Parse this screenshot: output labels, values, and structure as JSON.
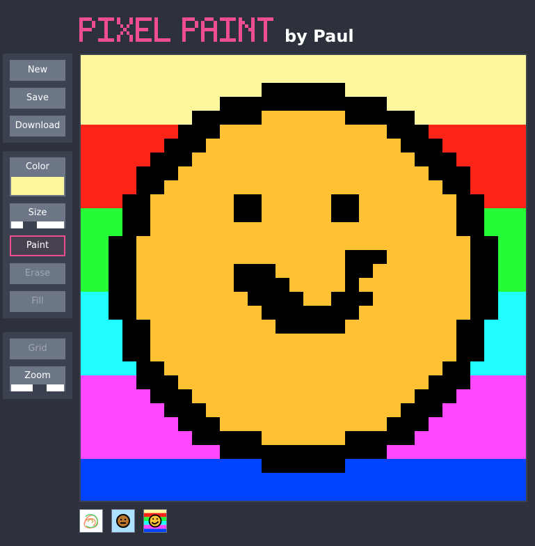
{
  "header": {
    "logo_text": "PIXEL PAINT",
    "byline": "by Paul",
    "logo_color": "#ee4e8f"
  },
  "file_panel": {
    "new_label": "New",
    "save_label": "Save",
    "download_label": "Download"
  },
  "tool_panel": {
    "color_label": "Color",
    "current_color": "#fff79c",
    "size_label": "Size",
    "size_level": 0.3,
    "paint_label": "Paint",
    "erase_label": "Erase",
    "fill_label": "Fill",
    "active_tool": "paint"
  },
  "view_panel": {
    "grid_label": "Grid",
    "zoom_label": "Zoom",
    "zoom_level": 0.55
  },
  "canvas": {
    "grid_size": 32,
    "stripes": [
      {
        "color": "#fff79c",
        "rows": 5
      },
      {
        "color": "#ff2418",
        "rows": 6
      },
      {
        "color": "#25fb36",
        "rows": 6
      },
      {
        "color": "#20fdff",
        "rows": 6
      },
      {
        "color": "#ff48ff",
        "rows": 6
      },
      {
        "color": "#0043ff",
        "rows": 3
      }
    ],
    "face_color": "#ffc234",
    "outline_color": "#000000"
  },
  "gallery": [
    {
      "name": "scribble-drawing-thumbnail"
    },
    {
      "name": "brown-face-thumbnail"
    },
    {
      "name": "rainbow-smiley-thumbnail"
    }
  ]
}
